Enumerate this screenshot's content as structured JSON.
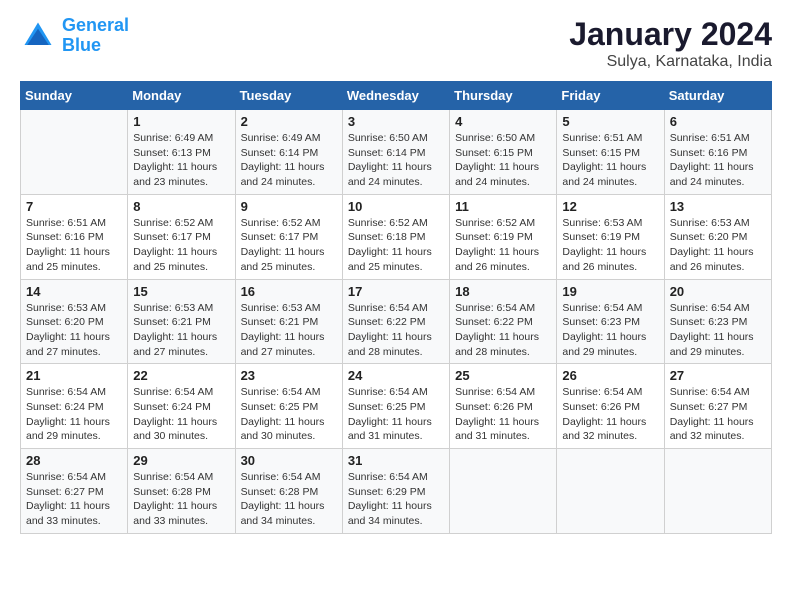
{
  "logo": {
    "text_general": "General",
    "text_blue": "Blue"
  },
  "title": "January 2024",
  "subtitle": "Sulya, Karnataka, India",
  "days_of_week": [
    "Sunday",
    "Monday",
    "Tuesday",
    "Wednesday",
    "Thursday",
    "Friday",
    "Saturday"
  ],
  "weeks": [
    [
      {
        "day": "",
        "info": ""
      },
      {
        "day": "1",
        "info": "Sunrise: 6:49 AM\nSunset: 6:13 PM\nDaylight: 11 hours\nand 23 minutes."
      },
      {
        "day": "2",
        "info": "Sunrise: 6:49 AM\nSunset: 6:14 PM\nDaylight: 11 hours\nand 24 minutes."
      },
      {
        "day": "3",
        "info": "Sunrise: 6:50 AM\nSunset: 6:14 PM\nDaylight: 11 hours\nand 24 minutes."
      },
      {
        "day": "4",
        "info": "Sunrise: 6:50 AM\nSunset: 6:15 PM\nDaylight: 11 hours\nand 24 minutes."
      },
      {
        "day": "5",
        "info": "Sunrise: 6:51 AM\nSunset: 6:15 PM\nDaylight: 11 hours\nand 24 minutes."
      },
      {
        "day": "6",
        "info": "Sunrise: 6:51 AM\nSunset: 6:16 PM\nDaylight: 11 hours\nand 24 minutes."
      }
    ],
    [
      {
        "day": "7",
        "info": "Sunrise: 6:51 AM\nSunset: 6:16 PM\nDaylight: 11 hours\nand 25 minutes."
      },
      {
        "day": "8",
        "info": "Sunrise: 6:52 AM\nSunset: 6:17 PM\nDaylight: 11 hours\nand 25 minutes."
      },
      {
        "day": "9",
        "info": "Sunrise: 6:52 AM\nSunset: 6:17 PM\nDaylight: 11 hours\nand 25 minutes."
      },
      {
        "day": "10",
        "info": "Sunrise: 6:52 AM\nSunset: 6:18 PM\nDaylight: 11 hours\nand 25 minutes."
      },
      {
        "day": "11",
        "info": "Sunrise: 6:52 AM\nSunset: 6:19 PM\nDaylight: 11 hours\nand 26 minutes."
      },
      {
        "day": "12",
        "info": "Sunrise: 6:53 AM\nSunset: 6:19 PM\nDaylight: 11 hours\nand 26 minutes."
      },
      {
        "day": "13",
        "info": "Sunrise: 6:53 AM\nSunset: 6:20 PM\nDaylight: 11 hours\nand 26 minutes."
      }
    ],
    [
      {
        "day": "14",
        "info": "Sunrise: 6:53 AM\nSunset: 6:20 PM\nDaylight: 11 hours\nand 27 minutes."
      },
      {
        "day": "15",
        "info": "Sunrise: 6:53 AM\nSunset: 6:21 PM\nDaylight: 11 hours\nand 27 minutes."
      },
      {
        "day": "16",
        "info": "Sunrise: 6:53 AM\nSunset: 6:21 PM\nDaylight: 11 hours\nand 27 minutes."
      },
      {
        "day": "17",
        "info": "Sunrise: 6:54 AM\nSunset: 6:22 PM\nDaylight: 11 hours\nand 28 minutes."
      },
      {
        "day": "18",
        "info": "Sunrise: 6:54 AM\nSunset: 6:22 PM\nDaylight: 11 hours\nand 28 minutes."
      },
      {
        "day": "19",
        "info": "Sunrise: 6:54 AM\nSunset: 6:23 PM\nDaylight: 11 hours\nand 29 minutes."
      },
      {
        "day": "20",
        "info": "Sunrise: 6:54 AM\nSunset: 6:23 PM\nDaylight: 11 hours\nand 29 minutes."
      }
    ],
    [
      {
        "day": "21",
        "info": "Sunrise: 6:54 AM\nSunset: 6:24 PM\nDaylight: 11 hours\nand 29 minutes."
      },
      {
        "day": "22",
        "info": "Sunrise: 6:54 AM\nSunset: 6:24 PM\nDaylight: 11 hours\nand 30 minutes."
      },
      {
        "day": "23",
        "info": "Sunrise: 6:54 AM\nSunset: 6:25 PM\nDaylight: 11 hours\nand 30 minutes."
      },
      {
        "day": "24",
        "info": "Sunrise: 6:54 AM\nSunset: 6:25 PM\nDaylight: 11 hours\nand 31 minutes."
      },
      {
        "day": "25",
        "info": "Sunrise: 6:54 AM\nSunset: 6:26 PM\nDaylight: 11 hours\nand 31 minutes."
      },
      {
        "day": "26",
        "info": "Sunrise: 6:54 AM\nSunset: 6:26 PM\nDaylight: 11 hours\nand 32 minutes."
      },
      {
        "day": "27",
        "info": "Sunrise: 6:54 AM\nSunset: 6:27 PM\nDaylight: 11 hours\nand 32 minutes."
      }
    ],
    [
      {
        "day": "28",
        "info": "Sunrise: 6:54 AM\nSunset: 6:27 PM\nDaylight: 11 hours\nand 33 minutes."
      },
      {
        "day": "29",
        "info": "Sunrise: 6:54 AM\nSunset: 6:28 PM\nDaylight: 11 hours\nand 33 minutes."
      },
      {
        "day": "30",
        "info": "Sunrise: 6:54 AM\nSunset: 6:28 PM\nDaylight: 11 hours\nand 34 minutes."
      },
      {
        "day": "31",
        "info": "Sunrise: 6:54 AM\nSunset: 6:29 PM\nDaylight: 11 hours\nand 34 minutes."
      },
      {
        "day": "",
        "info": ""
      },
      {
        "day": "",
        "info": ""
      },
      {
        "day": "",
        "info": ""
      }
    ]
  ]
}
